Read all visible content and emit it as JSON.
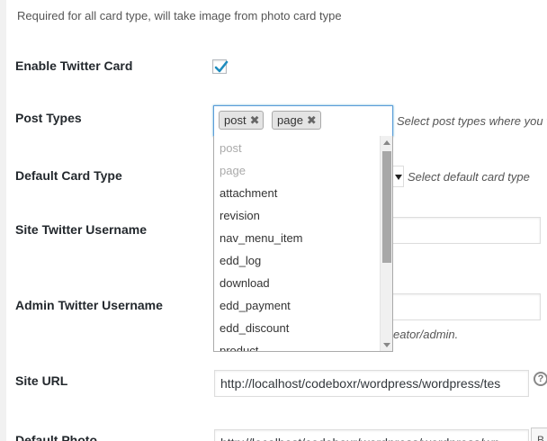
{
  "description_top": "Required for all card type, will take image from photo card type",
  "enable_twitter_card": {
    "label": "Enable Twitter Card",
    "checked": true
  },
  "post_types": {
    "label": "Post Types",
    "selected": [
      "post",
      "page"
    ],
    "remove_symbol": "✖",
    "help": "Select post types where you w",
    "options": [
      "post",
      "page",
      "attachment",
      "revision",
      "nav_menu_item",
      "edd_log",
      "download",
      "edd_payment",
      "edd_discount",
      "product"
    ],
    "disabled_options": [
      "post",
      "page"
    ]
  },
  "default_card_type": {
    "label": "Default Card Type",
    "help": "Select default card type"
  },
  "site_twitter_username": {
    "label": "Site Twitter Username"
  },
  "admin_twitter_username": {
    "label": "Admin Twitter Username",
    "help": "eator/admin."
  },
  "site_url": {
    "label": "Site URL",
    "value": "http://localhost/codeboxr/wordpress/wordpress/tes"
  },
  "default_photo": {
    "label": "Default Photo",
    "value": "http://localhost/codeboxr/wordpress/wordpress/wp",
    "button_fragment": "B"
  },
  "help_icon_symbol": "?"
}
